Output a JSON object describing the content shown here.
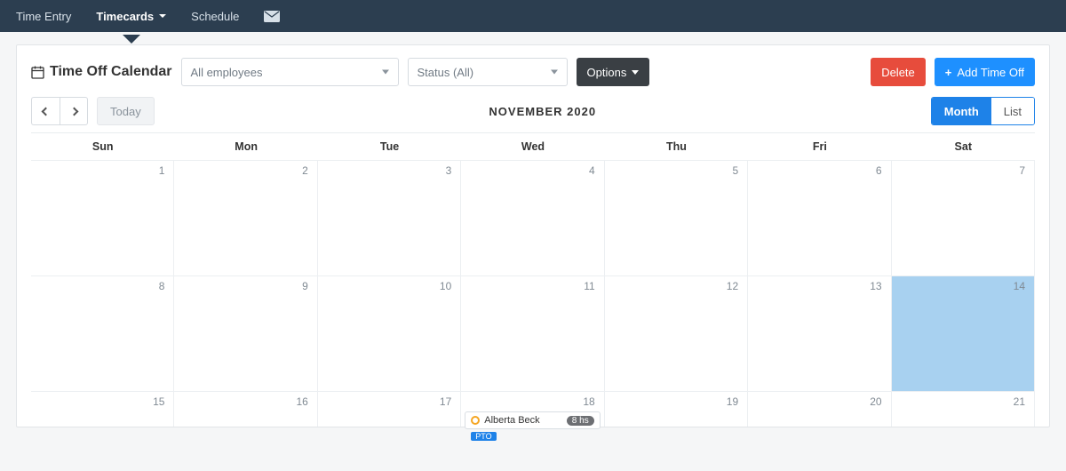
{
  "nav": {
    "time_entry": "Time Entry",
    "timecards": "Timecards",
    "schedule": "Schedule"
  },
  "header": {
    "title": "Time Off Calendar",
    "employees_placeholder": "All employees",
    "status_placeholder": "Status (All)",
    "options_label": "Options",
    "delete_label": "Delete",
    "add_label": "Add Time Off"
  },
  "calendar": {
    "today_label": "Today",
    "month_label": "NOVEMBER 2020",
    "view_month": "Month",
    "view_list": "List",
    "day_headers": [
      "Sun",
      "Mon",
      "Tue",
      "Wed",
      "Thu",
      "Fri",
      "Sat"
    ],
    "weeks": [
      [
        1,
        2,
        3,
        4,
        5,
        6,
        7
      ],
      [
        8,
        9,
        10,
        11,
        12,
        13,
        14
      ],
      [
        15,
        16,
        17,
        18,
        19,
        20,
        21
      ]
    ],
    "selected_day": 14
  },
  "event": {
    "name": "Alberta Beck",
    "hours": "8 hs",
    "tag": "PTO"
  }
}
